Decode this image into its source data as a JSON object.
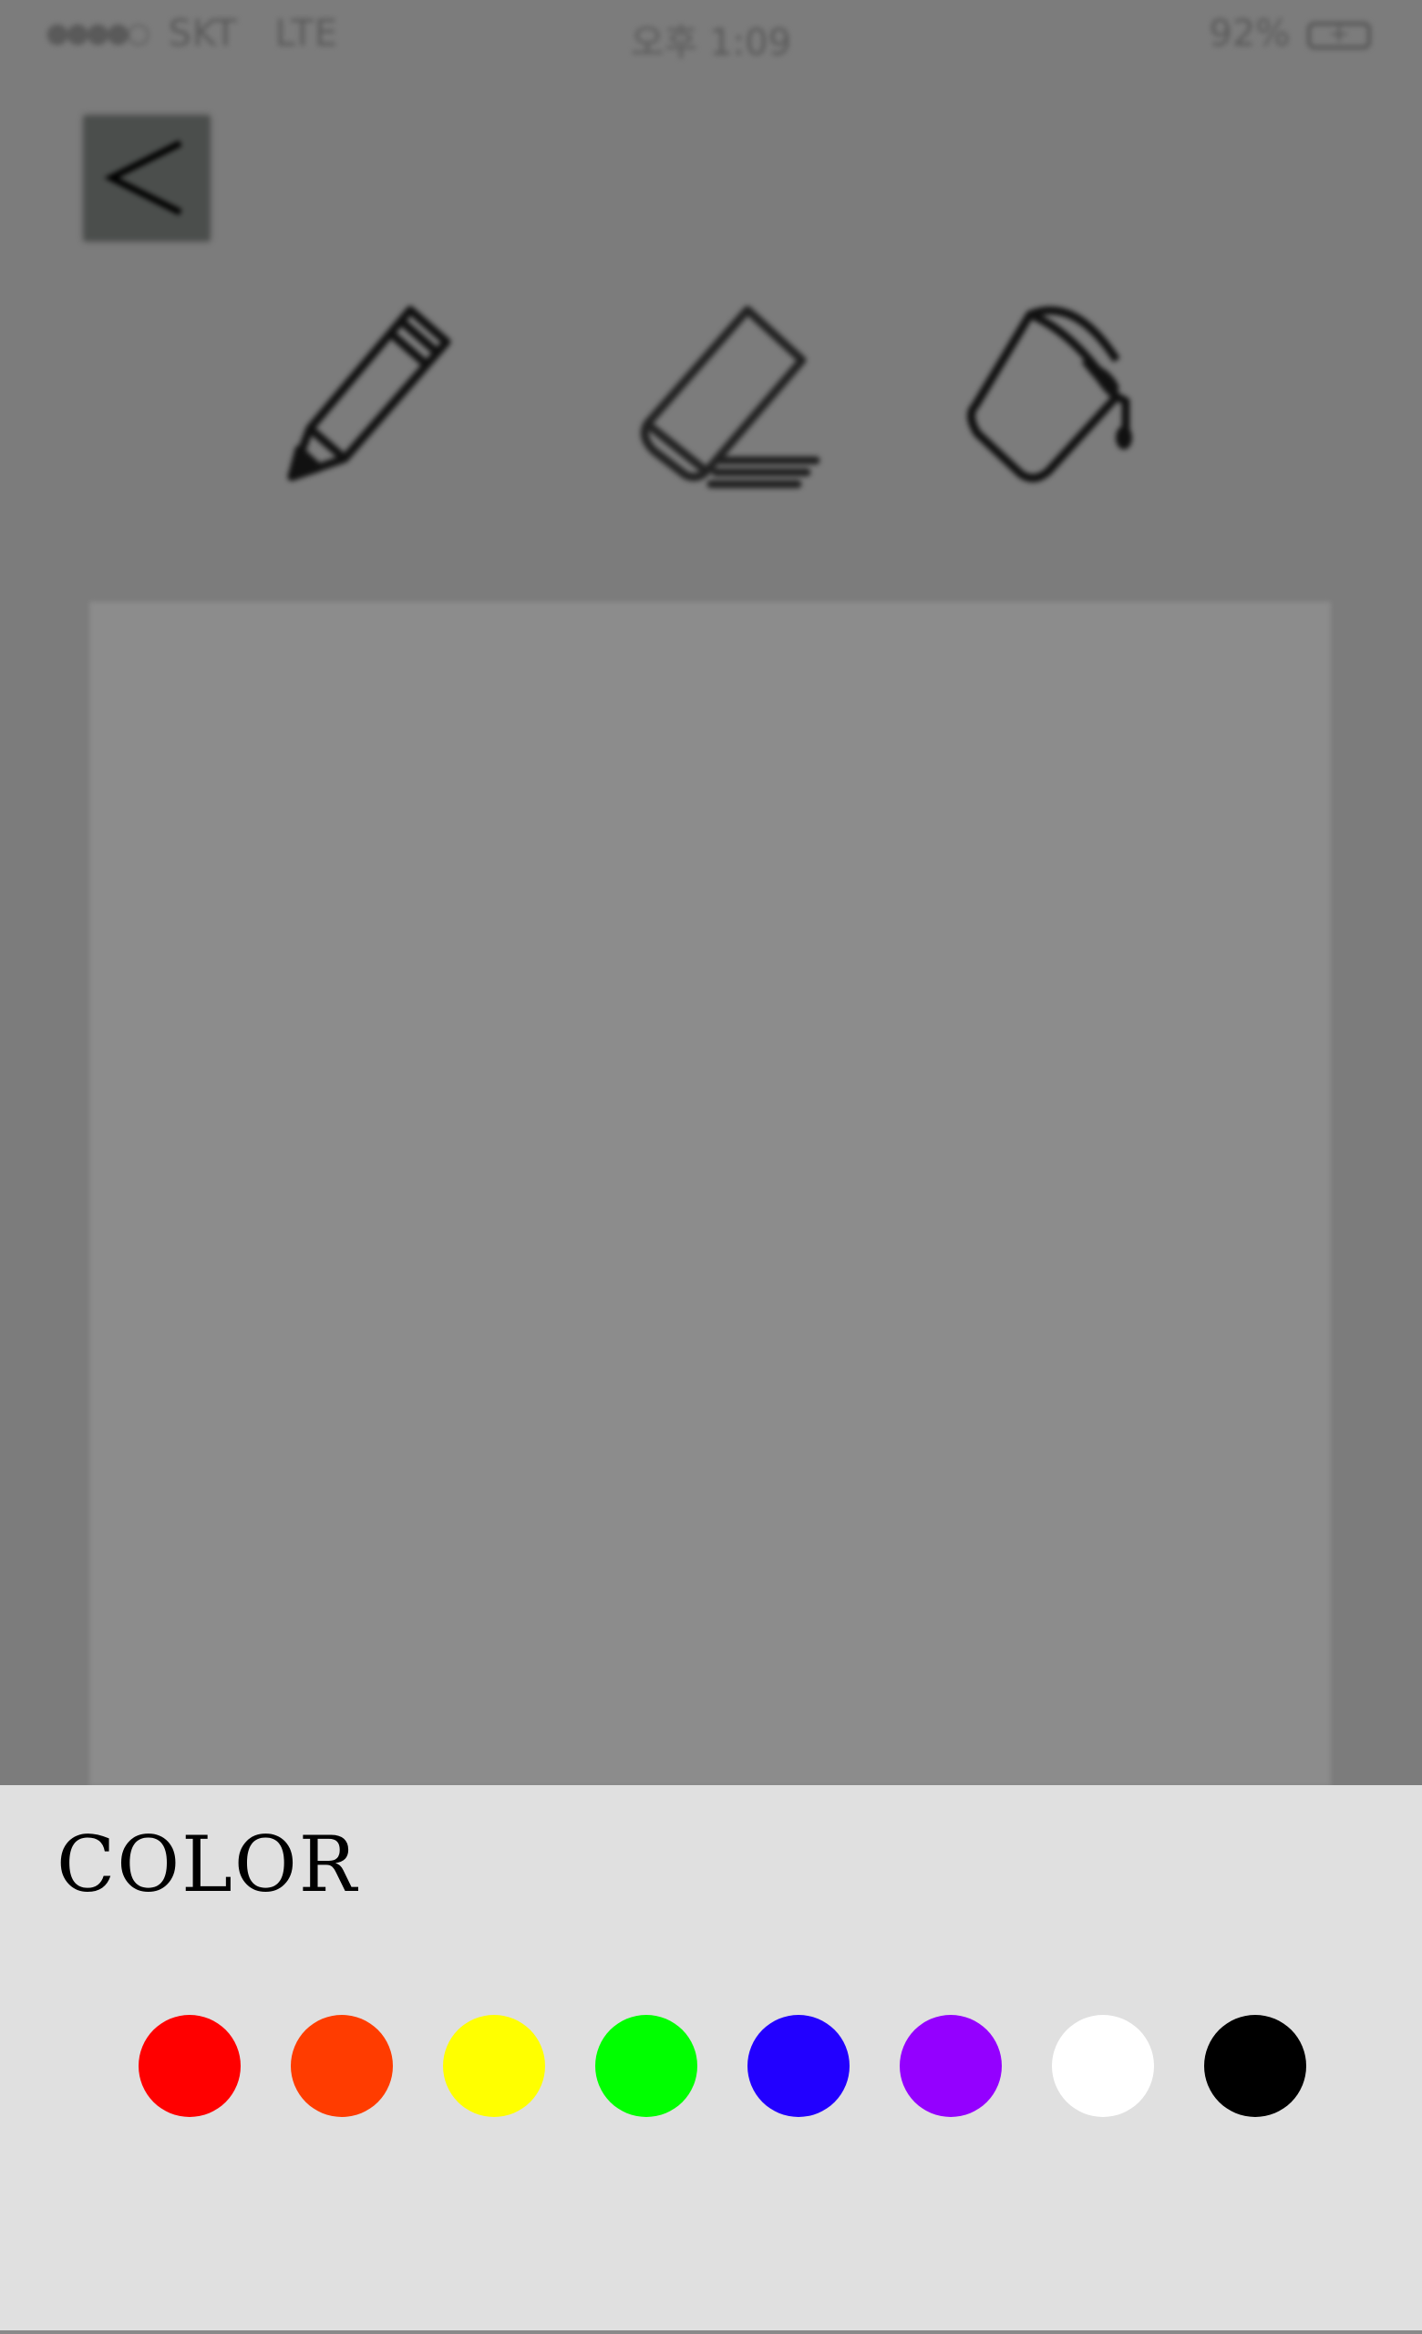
{
  "status_bar": {
    "signal": "●●●●○",
    "carrier": "SKT",
    "network": "LTE",
    "time": "오후 1:09",
    "battery_percent": "92%"
  },
  "toolbar": {
    "back_icon": "chevron-left-icon",
    "tools": [
      {
        "name": "pencil",
        "icon": "pencil-icon"
      },
      {
        "name": "eraser",
        "icon": "eraser-icon"
      },
      {
        "name": "paint-bucket",
        "icon": "paint-bucket-icon"
      }
    ]
  },
  "color_sheet": {
    "title": "COLOR",
    "swatches": [
      {
        "name": "red",
        "color": "#ff0000"
      },
      {
        "name": "orange",
        "color": "#ff3c00"
      },
      {
        "name": "yellow",
        "color": "#ffff00"
      },
      {
        "name": "green",
        "color": "#00ff00"
      },
      {
        "name": "blue",
        "color": "#2200ff"
      },
      {
        "name": "purple",
        "color": "#9400ff"
      },
      {
        "name": "white",
        "color": "#ffffff"
      },
      {
        "name": "black",
        "color": "#000000"
      }
    ]
  }
}
